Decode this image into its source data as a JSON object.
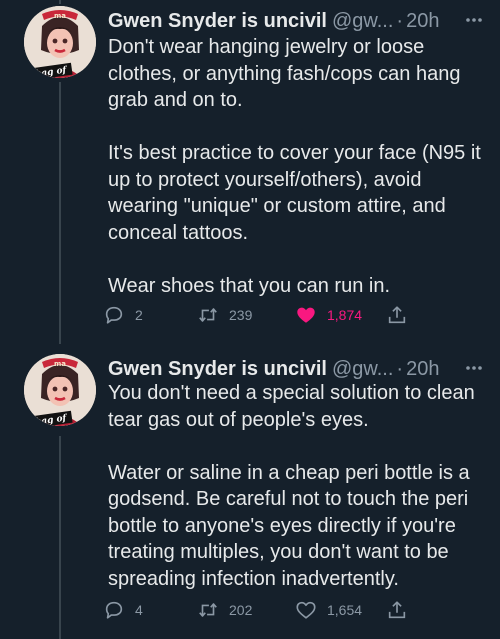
{
  "tweets": [
    {
      "name": "Gwen Snyder is uncivil",
      "handle": "@gw...",
      "separator": "·",
      "time": "20h",
      "avatar_banner_top": "ma",
      "avatar_banner_side": "a bag of",
      "paragraphs": [
        "Don't wear hanging jewelry or loose clothes, or anything fash/cops can hang grab and on to.",
        "It's best practice to cover your face (N95 it up to protect yourself/others), avoid wearing \"unique\" or custom attire, and conceal tattoos.",
        "Wear shoes that you can run in."
      ],
      "actions": {
        "replies": "2",
        "retweets": "239",
        "likes": "1,874",
        "liked": true
      }
    },
    {
      "name": "Gwen Snyder is uncivil",
      "handle": "@gw...",
      "separator": "·",
      "time": "20h",
      "avatar_banner_top": "ma",
      "avatar_banner_side": "a bag of",
      "paragraphs": [
        "You don't need a special solution to clean tear gas out of people's eyes.",
        "Water or saline in a cheap peri bottle is a godsend. Be careful not to touch the peri bottle to anyone's eyes directly if you're treating multiples, you don't want to be spreading infection inadvertently."
      ],
      "actions": {
        "replies": "4",
        "retweets": "202",
        "likes": "1,654",
        "liked": false
      }
    }
  ],
  "icons": {
    "reply": "reply-icon",
    "retweet": "retweet-icon",
    "like": "heart-icon",
    "share": "share-icon",
    "more": "more-icon"
  },
  "colors": {
    "background": "#15202b",
    "text": "#e7e9ea",
    "secondary": "#8b98a5",
    "like_active": "#f91880",
    "thread_line": "#38444d"
  }
}
